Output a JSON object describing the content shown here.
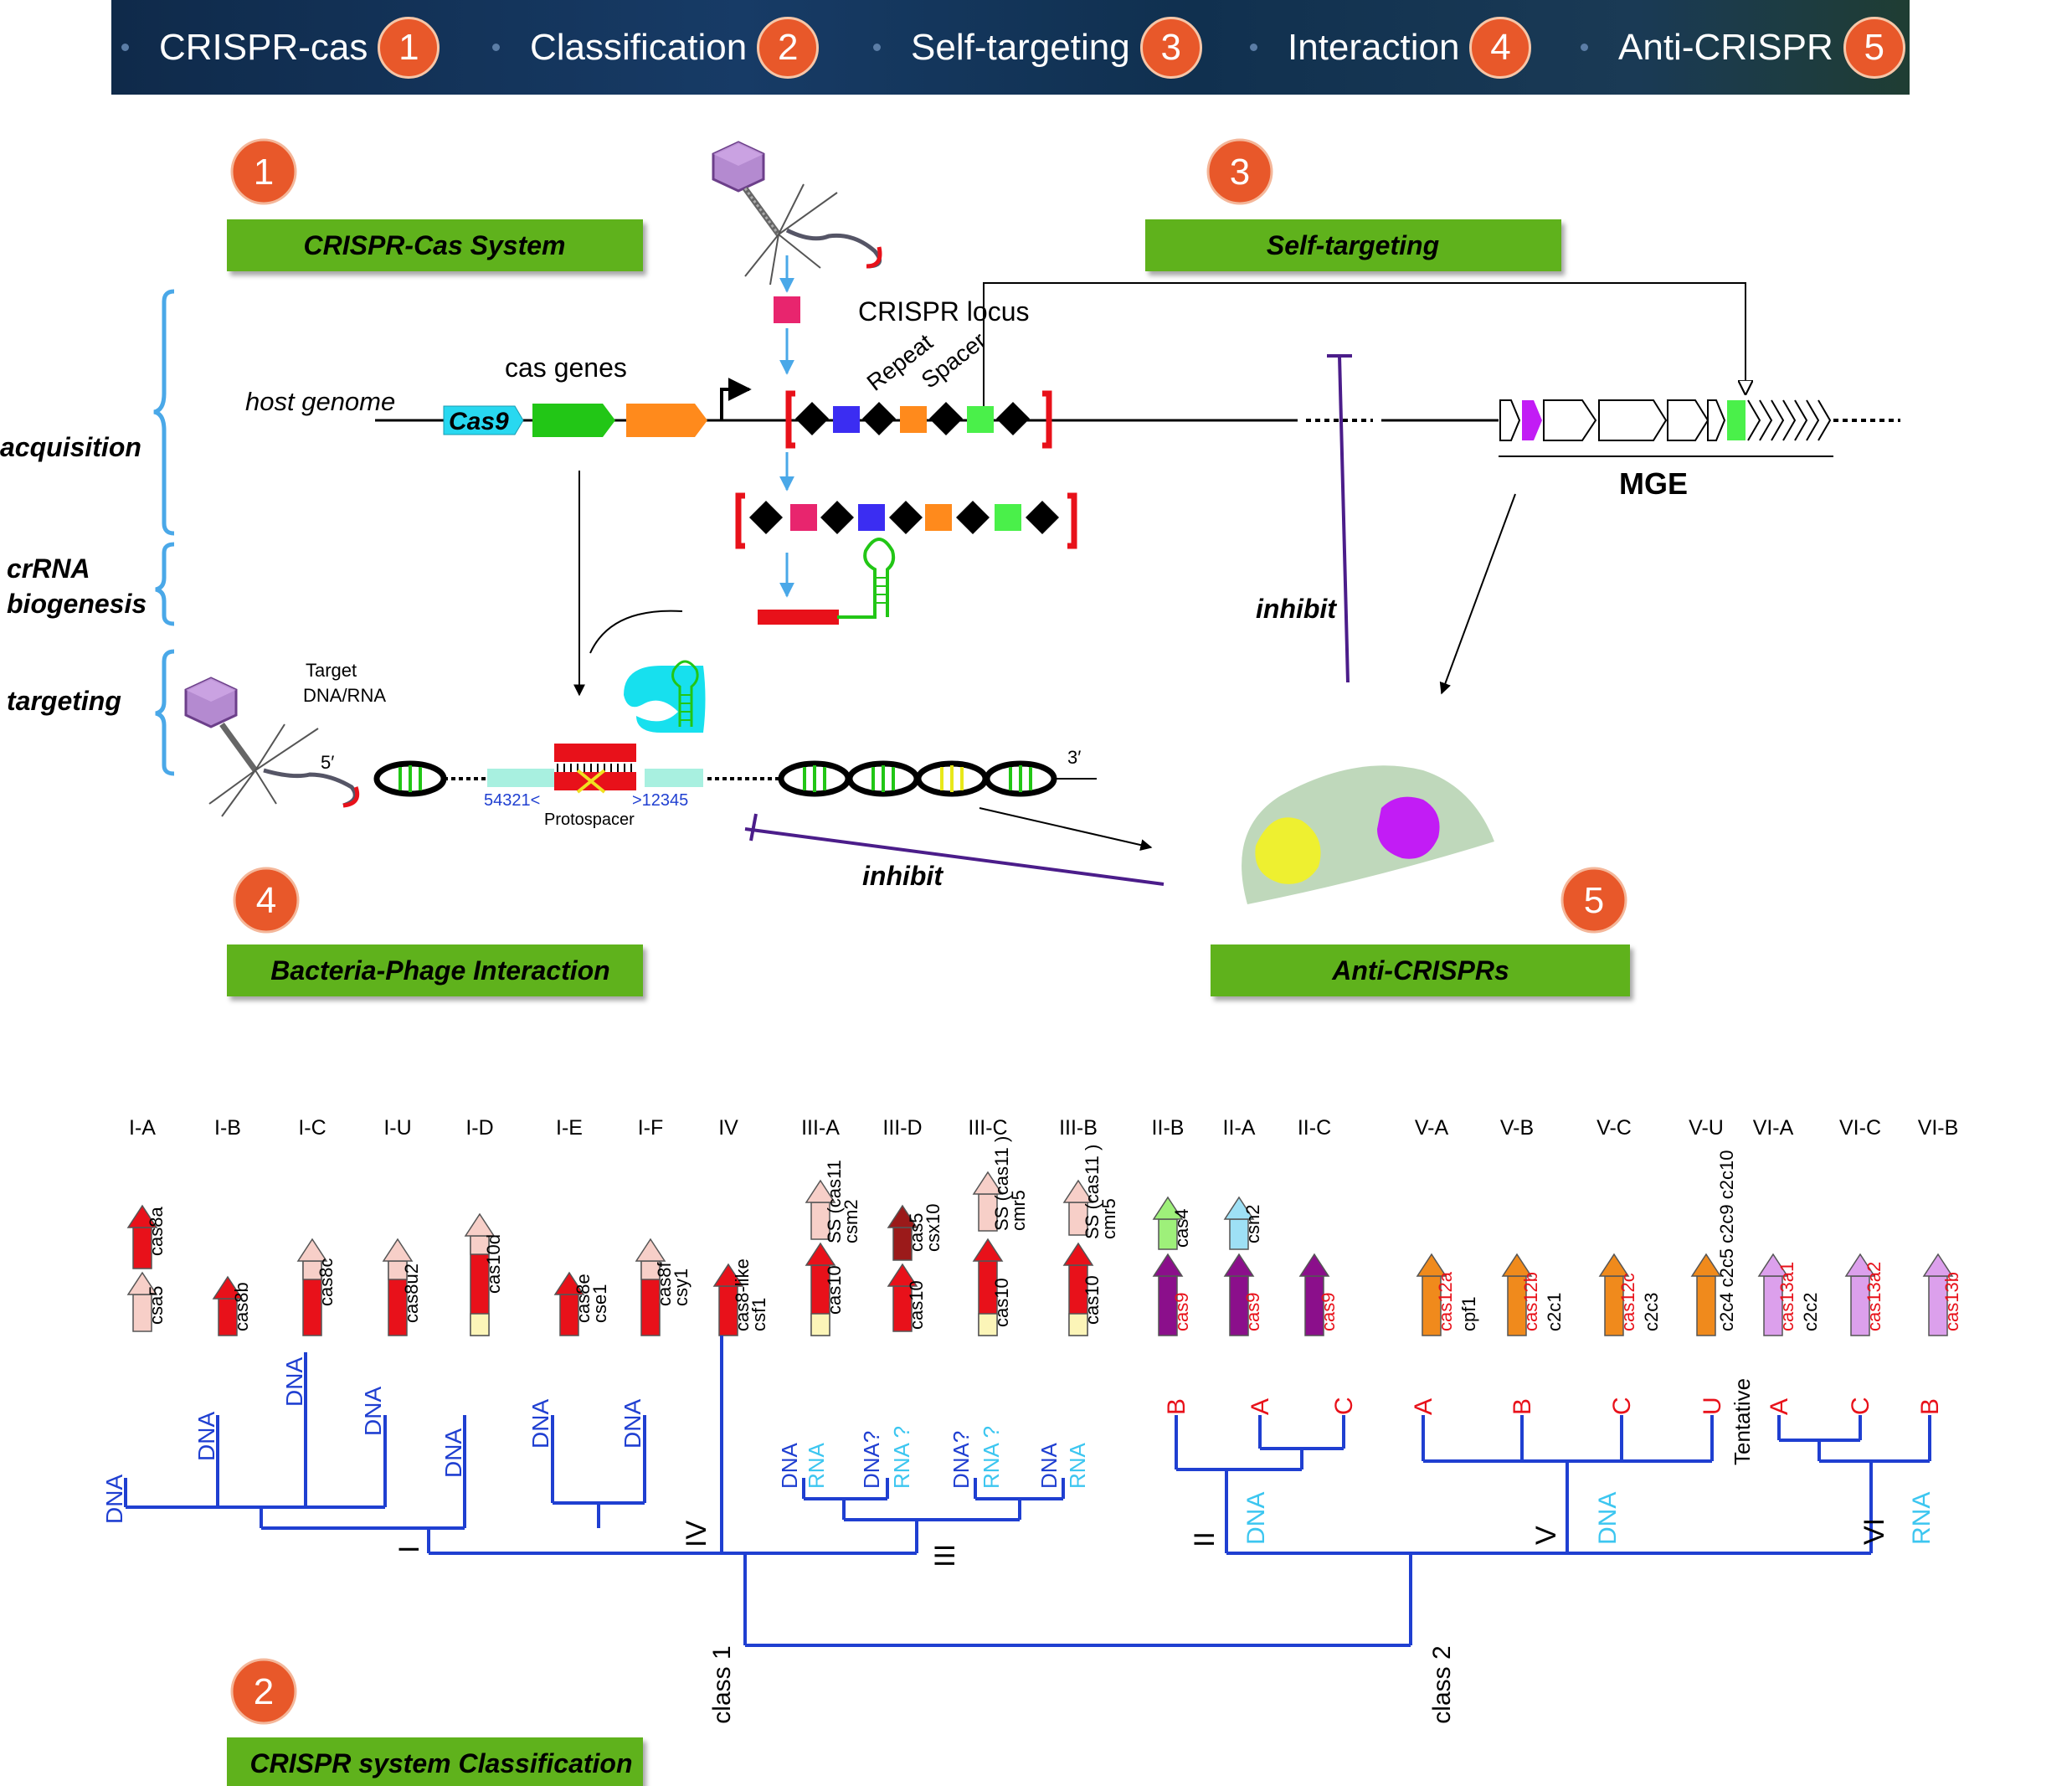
{
  "nav": {
    "items": [
      {
        "label": "CRISPR-cas",
        "badge": "1"
      },
      {
        "label": "Classification",
        "badge": "2"
      },
      {
        "label": "Self-targeting",
        "badge": "3"
      },
      {
        "label": "Interaction",
        "badge": "4"
      },
      {
        "label": "Anti-CRISPR",
        "badge": "5"
      }
    ]
  },
  "sections": {
    "crispr_cas": {
      "badge": "1",
      "title": "CRISPR-Cas System"
    },
    "classification": {
      "badge": "2",
      "title": "CRISPR system Classification"
    },
    "self_targeting": {
      "badge": "3",
      "title": "Self-targeting"
    },
    "interaction": {
      "badge": "4",
      "title": "Bacteria-Phage Interaction"
    },
    "anti_crispr": {
      "badge": "5",
      "title": "Anti-CRISPRs"
    }
  },
  "stages": {
    "acquisition": "acquisition",
    "crrna_1": "crRNA",
    "crrna_2": "biogenesis",
    "targeting": "targeting"
  },
  "mechanism": {
    "host_genome": "host genome",
    "cas_genes": "cas genes",
    "cas9": "Cas9",
    "crispr_locus": "CRISPR locus",
    "repeat": "Repeat",
    "spacer": "Spacer",
    "mge": "MGE",
    "inhibit_1": "inhibit",
    "inhibit_2": "inhibit",
    "target_1": "Target",
    "target_2": "DNA/RNA",
    "five_prime": "5′",
    "three_prime": "3′",
    "left_seq": "54321<",
    "right_seq": ">12345",
    "protospacer": "Protospacer"
  },
  "classification": {
    "subtypes": [
      {
        "label": "I-A",
        "genes": [
          "cas8a",
          "csa5"
        ]
      },
      {
        "label": "I-B",
        "genes": [
          "cas8b"
        ]
      },
      {
        "label": "I-C",
        "genes": [
          "cas8c"
        ]
      },
      {
        "label": "I-U",
        "genes": [
          "cas8u2"
        ]
      },
      {
        "label": "I-D",
        "genes": [
          "cas10d"
        ]
      },
      {
        "label": "I-E",
        "genes": [
          "cas8e",
          "cse1"
        ]
      },
      {
        "label": "I-F",
        "genes": [
          "cas8f",
          "csy1"
        ]
      },
      {
        "label": "IV",
        "genes": [
          "cas8-like",
          "csf1"
        ]
      },
      {
        "label": "III-A",
        "genes": [
          "SS (cas11",
          "csm2",
          "cas10"
        ]
      },
      {
        "label": "III-D",
        "genes": [
          "cas5",
          "csx10",
          "cas10"
        ]
      },
      {
        "label": "III-C",
        "genes": [
          "SS (cas11 )",
          "cmr5",
          "cas10"
        ]
      },
      {
        "label": "III-B",
        "genes": [
          "SS (cas11 )",
          "cmr5",
          "cas10"
        ]
      },
      {
        "label": "II-B",
        "genes": [
          "cas4",
          "cas9"
        ]
      },
      {
        "label": "II-A",
        "genes": [
          "csn2",
          "cas9"
        ]
      },
      {
        "label": "II-C",
        "genes": [
          "cas9"
        ]
      },
      {
        "label": "V-A",
        "genes": [
          "cas12a",
          "cpf1"
        ]
      },
      {
        "label": "V-B",
        "genes": [
          "cas12b",
          "c2c1"
        ]
      },
      {
        "label": "V-C",
        "genes": [
          "cas12c",
          "c2c3"
        ]
      },
      {
        "label": "V-U",
        "genes": [
          "c2c4 c2c5 c2c9 c2c10"
        ]
      },
      {
        "label": "VI-A",
        "genes": [
          "cas13a1",
          "c2c2"
        ]
      },
      {
        "label": "VI-C",
        "genes": [
          "cas13a2"
        ]
      },
      {
        "label": "VI-B",
        "genes": [
          "cas13b"
        ]
      }
    ],
    "targets": {
      "dna": "DNA",
      "rna": "RNA",
      "dna_q": "DNA?",
      "rna_q": "RNA ?"
    },
    "types": {
      "i": "I",
      "iii": "III",
      "iv": "IV",
      "ii": "II",
      "v": "V",
      "vi": "VI"
    },
    "leaves2": {
      "b": "B",
      "a": "A",
      "c": "C",
      "u": "U"
    },
    "tentative": "Tentative",
    "class1": "class 1",
    "class2": "class 2"
  },
  "colors": {
    "nav_badge": "#e8582a",
    "section_label_bg": "#5fb21d",
    "tree_blue": "#1f3fd1",
    "light_blue": "#3cc6f0",
    "cas_red": "#e8111a"
  }
}
